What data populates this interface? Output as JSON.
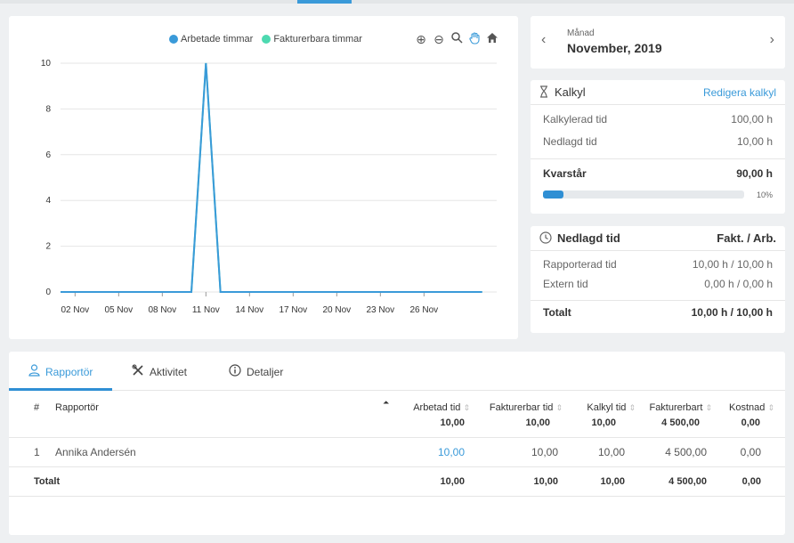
{
  "chart_data": {
    "type": "line",
    "x": [
      "01 Nov",
      "02 Nov",
      "03 Nov",
      "04 Nov",
      "05 Nov",
      "06 Nov",
      "07 Nov",
      "08 Nov",
      "09 Nov",
      "10 Nov",
      "11 Nov",
      "12 Nov",
      "13 Nov",
      "14 Nov",
      "15 Nov",
      "16 Nov",
      "17 Nov",
      "18 Nov",
      "19 Nov",
      "20 Nov",
      "21 Nov",
      "22 Nov",
      "23 Nov",
      "24 Nov",
      "25 Nov",
      "26 Nov",
      "27 Nov",
      "28 Nov",
      "29 Nov",
      "30 Nov"
    ],
    "tick_labels": [
      "02 Nov",
      "05 Nov",
      "08 Nov",
      "11 Nov",
      "14 Nov",
      "17 Nov",
      "20 Nov",
      "23 Nov",
      "26 Nov"
    ],
    "series": [
      {
        "name": "Arbetade timmar",
        "color": "#3a9ad9",
        "values": [
          0,
          0,
          0,
          0,
          0,
          0,
          0,
          0,
          0,
          0,
          10,
          0,
          0,
          0,
          0,
          0,
          0,
          0,
          0,
          0,
          0,
          0,
          0,
          0,
          0,
          0,
          0,
          0,
          0,
          0
        ]
      },
      {
        "name": "Fakturerbara timmar",
        "color": "#4dd9b0",
        "values": [
          0,
          0,
          0,
          0,
          0,
          0,
          0,
          0,
          0,
          0,
          10,
          0,
          0,
          0,
          0,
          0,
          0,
          0,
          0,
          0,
          0,
          0,
          0,
          0,
          0,
          0,
          0,
          0,
          0,
          0
        ]
      }
    ],
    "yticks": [
      "0",
      "2",
      "4",
      "6",
      "8",
      "10"
    ],
    "ylim": [
      0,
      10
    ],
    "grid": true,
    "legend": "top"
  },
  "toolbar": {
    "zoom_in": "⊕",
    "zoom_out": "⊖",
    "zoom": "🔍",
    "pan": "✋",
    "home": "⌂"
  },
  "month": {
    "label": "Månad",
    "value": "November, 2019",
    "prev": "‹",
    "next": "›"
  },
  "kalkyl": {
    "title": "Kalkyl",
    "edit_link": "Redigera kalkyl",
    "icon": "hourglass-icon",
    "rows": [
      {
        "label": "Kalkylerad tid",
        "value": "100,00 h"
      },
      {
        "label": "Nedlagd tid",
        "value": "10,00 h"
      }
    ],
    "remaining_label": "Kvarstår",
    "remaining_value": "90,00 h",
    "progress": 0.1,
    "progress_label": "10%"
  },
  "nedlagd": {
    "title": "Nedlagd tid",
    "right_header": "Fakt. / Arb.",
    "icon": "clock-icon",
    "rows": [
      {
        "label": "Rapporterad tid",
        "value": "10,00 h / 10,00 h"
      },
      {
        "label": "Extern tid",
        "value": "0,00 h / 0,00 h"
      }
    ],
    "total_label": "Totalt",
    "total_value": "10,00 h / 10,00 h"
  },
  "tabs": [
    {
      "label": "Rapportör",
      "icon": "user-icon",
      "active": true
    },
    {
      "label": "Aktivitet",
      "icon": "tools-icon",
      "active": false
    },
    {
      "label": "Detaljer",
      "icon": "info-icon",
      "active": false
    }
  ],
  "table": {
    "columns": [
      {
        "label": "#",
        "total": ""
      },
      {
        "label": "Rapportör",
        "total": ""
      },
      {
        "label": "Arbetad tid",
        "total": "10,00"
      },
      {
        "label": "Fakturerbar tid",
        "total": "10,00"
      },
      {
        "label": "Kalkyl tid",
        "total": "10,00"
      },
      {
        "label": "Fakturerbart",
        "total": "4 500,00"
      },
      {
        "label": "Kostnad",
        "total": "0,00"
      }
    ],
    "rows": [
      {
        "num": "1",
        "name": "Annika Andersén",
        "arbetad": "10,00",
        "fakturerbar": "10,00",
        "kalkyl": "10,00",
        "fakturerbart": "4 500,00",
        "kostnad": "0,00"
      }
    ],
    "footer": {
      "label": "Totalt",
      "arbetad": "10,00",
      "fakturerbar": "10,00",
      "kalkyl": "10,00",
      "fakturerbart": "4 500,00",
      "kostnad": "0,00"
    }
  }
}
